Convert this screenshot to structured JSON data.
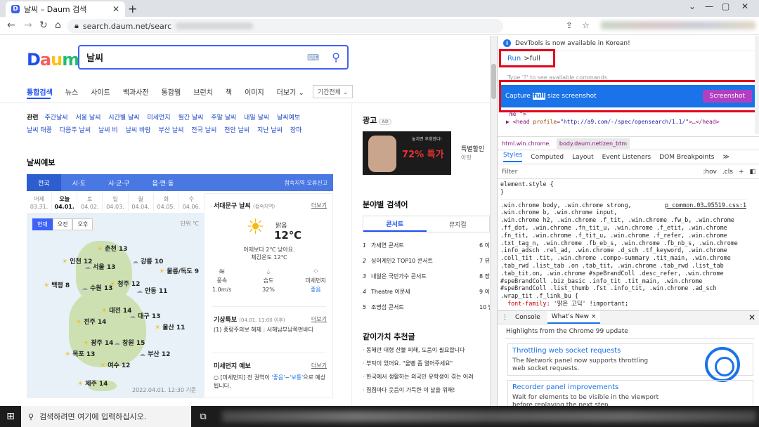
{
  "browser": {
    "tab_title": "날씨 – Daum 검색",
    "favicon_letter": "D",
    "url": "search.daum.net/searc"
  },
  "page": {
    "logo": "Daum",
    "search_value": "날씨",
    "tabs": [
      "통합검색",
      "뉴스",
      "사이트",
      "백과사전",
      "통합웹",
      "브런치",
      "책",
      "이미지",
      "더보기 ⌄"
    ],
    "period": "기간전체 ⌄",
    "related_label": "관련",
    "related": [
      "주간날씨",
      "서울 날씨",
      "시간별 날씨",
      "미세먼지",
      "월간 날씨",
      "주말 날씨",
      "내일 날씨",
      "날씨예보",
      "날씨 태풍",
      "다음주 날씨",
      "날씨 비",
      "날씨 바람",
      "부산 날씨",
      "전국 날씨",
      "천안 날씨",
      "지난 날씨",
      "장마"
    ],
    "forecast_title": "날씨예보",
    "breadcrumb": [
      "전국",
      "시·도",
      "시·군·구",
      "읍·면·동"
    ],
    "location_note": "접속지역 오류신고",
    "days": [
      {
        "d": "어제",
        "dt": "03.31."
      },
      {
        "d": "오늘",
        "dt": "04.01."
      },
      {
        "d": "토",
        "dt": "04.02."
      },
      {
        "d": "일",
        "dt": "04.03."
      },
      {
        "d": "월",
        "dt": "04.04."
      },
      {
        "d": "화",
        "dt": "04.05."
      },
      {
        "d": "수",
        "dt": "04.06."
      }
    ],
    "map_modes": [
      "현재",
      "오전",
      "오후"
    ],
    "unit": "단위 ℃",
    "cities": [
      {
        "name": "춘천",
        "t": "13"
      },
      {
        "name": "인천",
        "t": "12"
      },
      {
        "name": "서울",
        "t": "13"
      },
      {
        "name": "강릉",
        "t": "10"
      },
      {
        "name": "울릉/독도",
        "t": "9"
      },
      {
        "name": "백령",
        "t": "8"
      },
      {
        "name": "수원",
        "t": "13"
      },
      {
        "name": "청주",
        "t": "12"
      },
      {
        "name": "안동",
        "t": "11"
      },
      {
        "name": "대전",
        "t": "14"
      },
      {
        "name": "전주",
        "t": "14"
      },
      {
        "name": "대구",
        "t": "13"
      },
      {
        "name": "울산",
        "t": "11"
      },
      {
        "name": "광주",
        "t": "14"
      },
      {
        "name": "창원",
        "t": "15"
      },
      {
        "name": "목포",
        "t": "13"
      },
      {
        "name": "부산",
        "t": "12"
      },
      {
        "name": "여수",
        "t": "12"
      },
      {
        "name": "제주",
        "t": "14"
      }
    ],
    "map_time": "2022.04.01. 12:30 기준",
    "panel": {
      "location": "서대문구 날씨",
      "location_note": "(접속지역)",
      "more": "더보기",
      "condition": "맑음",
      "temp": "12℃",
      "compare": "어제보다 2℃ 낮아요.",
      "feels": "체감온도 12℃",
      "stats": [
        {
          "label": "풍속",
          "value": "1.0m/s"
        },
        {
          "label": "습도",
          "value": "32%"
        },
        {
          "label": "미세먼지",
          "value": "좋음"
        }
      ],
      "alert_title": "기상특보",
      "alert_time": "(04.01. 11:00 이후)",
      "alert_text": "(1) 풍랑주의보 해제 : 서해남부남쪽먼바다",
      "dust_title": "미세먼지 예보",
      "dust_text_pre": "○ [미세먼지] 전 권역이 ",
      "dust_good1": "'좋음'",
      "dust_mid": "~",
      "dust_good2": "'보통'",
      "dust_text_post": "으로 예상됩니다."
    },
    "ad_label": "광고",
    "ad_badge": "AD",
    "ad_small": "놓치면 후회한다!",
    "ad_big": "72% 특가",
    "ad_title": "특별할인",
    "ad_sub": "아핏",
    "category_title": "분야별 검색어",
    "category_tabs": [
      "콘서트",
      "뮤지컬"
    ],
    "ranks": [
      {
        "n": "1",
        "t": "가세연 콘서트",
        "r": "6 이승"
      },
      {
        "n": "2",
        "t": "싱어게인2 TOP10 콘서트",
        "r": "7 뷰티"
      },
      {
        "n": "3",
        "t": "내일은 국민가수 콘서트",
        "r": "8 장범"
      },
      {
        "n": "4",
        "t": "Theatre 이문세",
        "r": "9 이은"
      },
      {
        "n": "5",
        "t": "조명섭 콘서트",
        "r": "10 범이"
      }
    ],
    "values_title": "같이가치 추천글",
    "news": [
      "동해안 대형 산불 피해, 도움이 필요합니다",
      "부탁이 있어요. \"울뻥 좀 열어주세요\"",
      "한국에서 생활하는 외국인 유학생이 겪는 어려",
      "집집마다 웃음이 가득한 이 날을 위해!"
    ]
  },
  "devtools": {
    "info": "DevTools is now available in Korean!",
    "run": "Run",
    "command": ">full",
    "hint": "Type '?' to see available commands",
    "capture_pre": "Capture ",
    "capture_hl": "full",
    "capture_post": " size screenshot",
    "screenshot_btn": "Screenshot",
    "crumbs": [
      "html.win.chrome.",
      "body.daum.netizen_btm"
    ],
    "panel_tabs": [
      "Styles",
      "Computed",
      "Layout",
      "Event Listeners",
      "DOM Breakpoints",
      "≫"
    ],
    "filter": "Filter",
    "hov": ":hov",
    "cls": ".cls",
    "source": "p_common.03…95519.css:1",
    "drawer_tabs": [
      "Console",
      "What's New ×"
    ],
    "highlights": "Highlights from the Chrome 99 update",
    "card1_title": "Throttling web socket requests",
    "card1_desc": "The Network panel now supports throttling web socket requests.",
    "card2_title": "Recorder panel improvements",
    "card2_desc": "Wait for elements to be visible in the viewport before replaying the next step."
  },
  "taskbar": {
    "search_placeholder": "검색하려면 여기에 입력하십시오."
  }
}
